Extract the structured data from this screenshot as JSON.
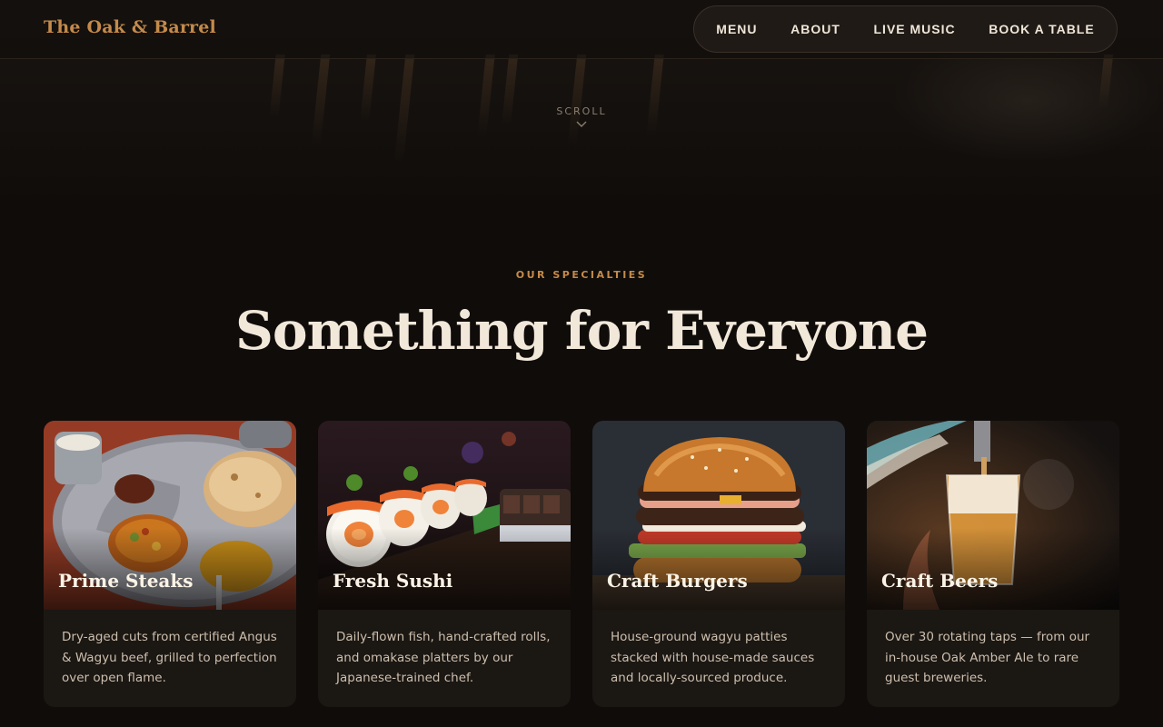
{
  "brand": {
    "name": "The Oak & Barrel"
  },
  "nav": {
    "items": [
      "MENU",
      "ABOUT",
      "LIVE MUSIC",
      "BOOK A TABLE"
    ]
  },
  "hero": {
    "scroll_label": "SCROLL",
    "scroll_icon": "chevron-down-icon"
  },
  "section": {
    "eyebrow": "OUR SPECIALTIES",
    "title": "Something for Everyone"
  },
  "cards": [
    {
      "name": "Prime Steaks",
      "desc": "Dry-aged cuts from certified Angus & Wagyu beef, grilled to perfection over open flame."
    },
    {
      "name": "Fresh Sushi",
      "desc": "Daily-flown fish, hand-crafted rolls, and omakase platters by our Japanese-trained chef."
    },
    {
      "name": "Craft Burgers",
      "desc": "House-ground wagyu patties stacked with house-made sauces and locally-sourced produce."
    },
    {
      "name": "Craft Beers",
      "desc": "Over 30 rotating taps — from our in-house Oak Amber Ale to rare guest breweries."
    }
  ],
  "colors": {
    "accent": "#c58a4a",
    "background": "#0f0c0a",
    "card": "#1b1713",
    "heading": "#f2e8da"
  }
}
